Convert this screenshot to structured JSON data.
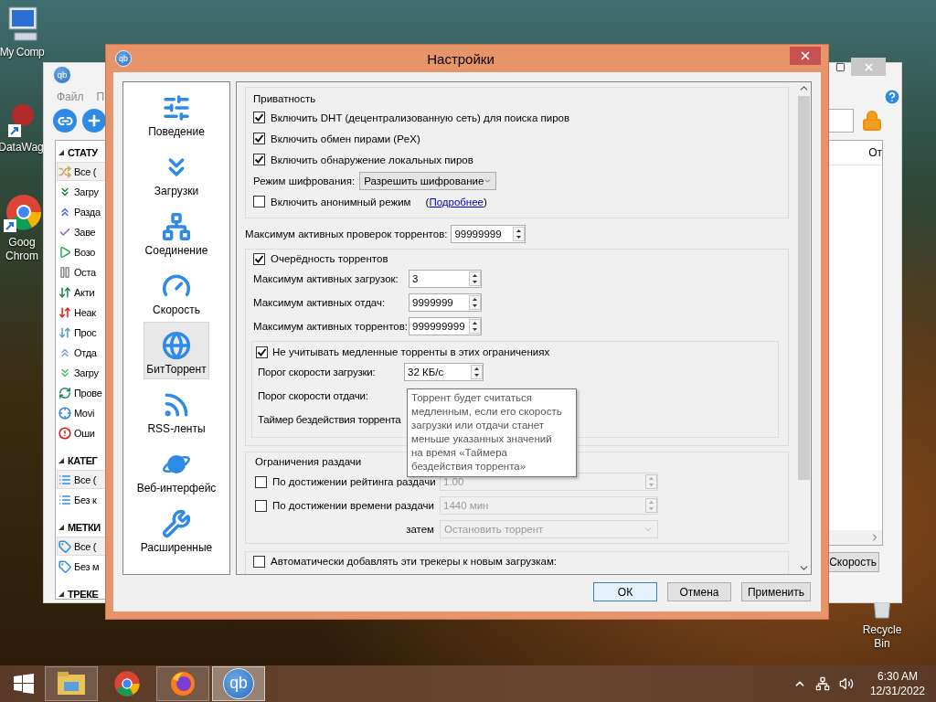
{
  "desktop": {
    "icons": [
      {
        "kind": "computer",
        "label": "My Comp"
      },
      {
        "kind": "app",
        "label": "DataWag"
      },
      {
        "kind": "browser",
        "label": "Goog Chrom"
      },
      {
        "kind": "trash",
        "label": "Recycle Bin"
      }
    ]
  },
  "background_window": {
    "icon_text": "qb",
    "menu": [
      "Файл",
      "П"
    ],
    "toolbar": [
      {
        "kind": "link"
      },
      {
        "kind": "add"
      }
    ],
    "sections": [
      {
        "title": "СТАТУ",
        "expanded": true,
        "items": [
          {
            "kind": "all",
            "label": "Все (",
            "selected": true
          },
          {
            "kind": "downloading",
            "label": "Загру",
            "selected": false
          },
          {
            "kind": "seeding",
            "label": "Разда",
            "selected": false
          },
          {
            "kind": "completed",
            "label": "Заве",
            "selected": false
          },
          {
            "kind": "resumed",
            "label": "Возо",
            "selected": false
          },
          {
            "kind": "paused",
            "label": "Оста",
            "selected": false
          },
          {
            "kind": "active",
            "label": "Акти",
            "selected": false
          },
          {
            "kind": "inactive",
            "label": "Неак",
            "selected": false
          },
          {
            "kind": "stalled",
            "label": "Прос",
            "selected": false
          },
          {
            "kind": "stalled_up",
            "label": "Отда",
            "selected": false
          },
          {
            "kind": "stalled_down",
            "label": "Загру",
            "selected": false
          },
          {
            "kind": "checking",
            "label": "Прове",
            "selected": false
          },
          {
            "kind": "moving",
            "label": "Movi",
            "selected": false
          },
          {
            "kind": "errored",
            "label": "Оши",
            "selected": false
          }
        ]
      },
      {
        "title": "КАТЕГ",
        "expanded": true,
        "items": [
          {
            "kind": "list",
            "label": "Все (",
            "selected": true
          },
          {
            "kind": "list",
            "label": "Без к",
            "selected": false
          }
        ]
      },
      {
        "title": "МЕТКИ",
        "expanded": true,
        "items": [
          {
            "kind": "tag",
            "label": "Все (",
            "selected": true
          },
          {
            "kind": "tag",
            "label": "Без м",
            "selected": false
          }
        ]
      },
      {
        "title": "ТРЕКЕ",
        "expanded": true
      }
    ],
    "column": "От",
    "speed_button": "Скорость"
  },
  "dialog": {
    "icon_text": "qb",
    "title": "Настройки",
    "pages": [
      {
        "kind": "behavior",
        "label": "Поведение",
        "selected": false
      },
      {
        "kind": "downloads",
        "label": "Загрузки",
        "selected": false
      },
      {
        "kind": "connection",
        "label": "Соединение",
        "selected": false
      },
      {
        "kind": "speed",
        "label": "Скорость",
        "selected": false
      },
      {
        "kind": "bittorrent",
        "label": "БитТоррент",
        "selected": true
      },
      {
        "kind": "rss",
        "label": "RSS-ленты",
        "selected": false
      },
      {
        "kind": "webui",
        "label": "Веб-интерфейс",
        "selected": false
      },
      {
        "kind": "advanced",
        "label": "Расширенные",
        "selected": false
      }
    ],
    "privacy": {
      "title": "Приватность",
      "options": [
        {
          "label": "Включить DHT (децентрализованную сеть) для поиска пиров",
          "checked": true
        },
        {
          "label": "Включить обмен пирами (PeX)",
          "checked": true
        },
        {
          "label": "Включить обнаружение локальных пиров",
          "checked": true
        }
      ],
      "encryption_label": "Режим шифрования:",
      "encryption_value": "Разрешить шифрование",
      "anonymous": {
        "label": "Включить анонимный режим",
        "checked": false
      },
      "more_prefix": "(",
      "more_link": "Подробнее",
      "more_suffix": ")"
    },
    "max_checks": {
      "label": "Максимум активных проверок торрентов:",
      "value": "99999999"
    },
    "queueing": {
      "label": "Очерёдность торрентов",
      "checked": true,
      "fields": [
        {
          "label": "Максимум активных загрузок:",
          "value": "3"
        },
        {
          "label": "Максимум активных отдач:",
          "value": "9999999"
        },
        {
          "label": "Максимум активных торрентов:",
          "value": "999999999"
        }
      ],
      "slow": {
        "label": "Не учитывать медленные торренты в этих ограничениях",
        "checked": true,
        "fields": [
          {
            "label": "Порог скорости загрузки:",
            "value": "32 КБ/с"
          },
          {
            "label": "Порог скорости отдачи:"
          },
          {
            "label": "Таймер бездействия торрента"
          }
        ]
      }
    },
    "tooltip": "Торрент будет считаться\nмедленным, если его скорость\nзагрузки или отдачи станет\nменьше указанных значений\nна время «Таймера\nбездействия торрента»",
    "seeding": {
      "title": "Ограничения раздачи",
      "ratio": {
        "label": "По достижении рейтинга раздачи",
        "checked": false,
        "value": "1.00"
      },
      "time": {
        "label": "По достижении времени раздачи",
        "checked": false,
        "value": "1440 мин"
      },
      "then_label": "затем",
      "then_value": "Остановить торрент"
    },
    "trackers": {
      "label": "Автоматически добавлять эти трекеры к новым загрузкам:",
      "checked": false
    },
    "buttons": [
      {
        "label": "ОК",
        "default": true
      },
      {
        "label": "Отмена",
        "default": false
      },
      {
        "label": "Применить",
        "default": false
      }
    ]
  },
  "taskbar": {
    "apps": [
      {
        "kind": "explorer",
        "running": true,
        "selected": false
      },
      {
        "kind": "chrome",
        "running": false,
        "selected": false
      },
      {
        "kind": "firefox",
        "running": true,
        "selected": false
      },
      {
        "kind": "qbittorrent",
        "label": "qb",
        "running": true,
        "selected": true
      }
    ],
    "time": "6:30 AM",
    "date": "12/31/2022"
  }
}
